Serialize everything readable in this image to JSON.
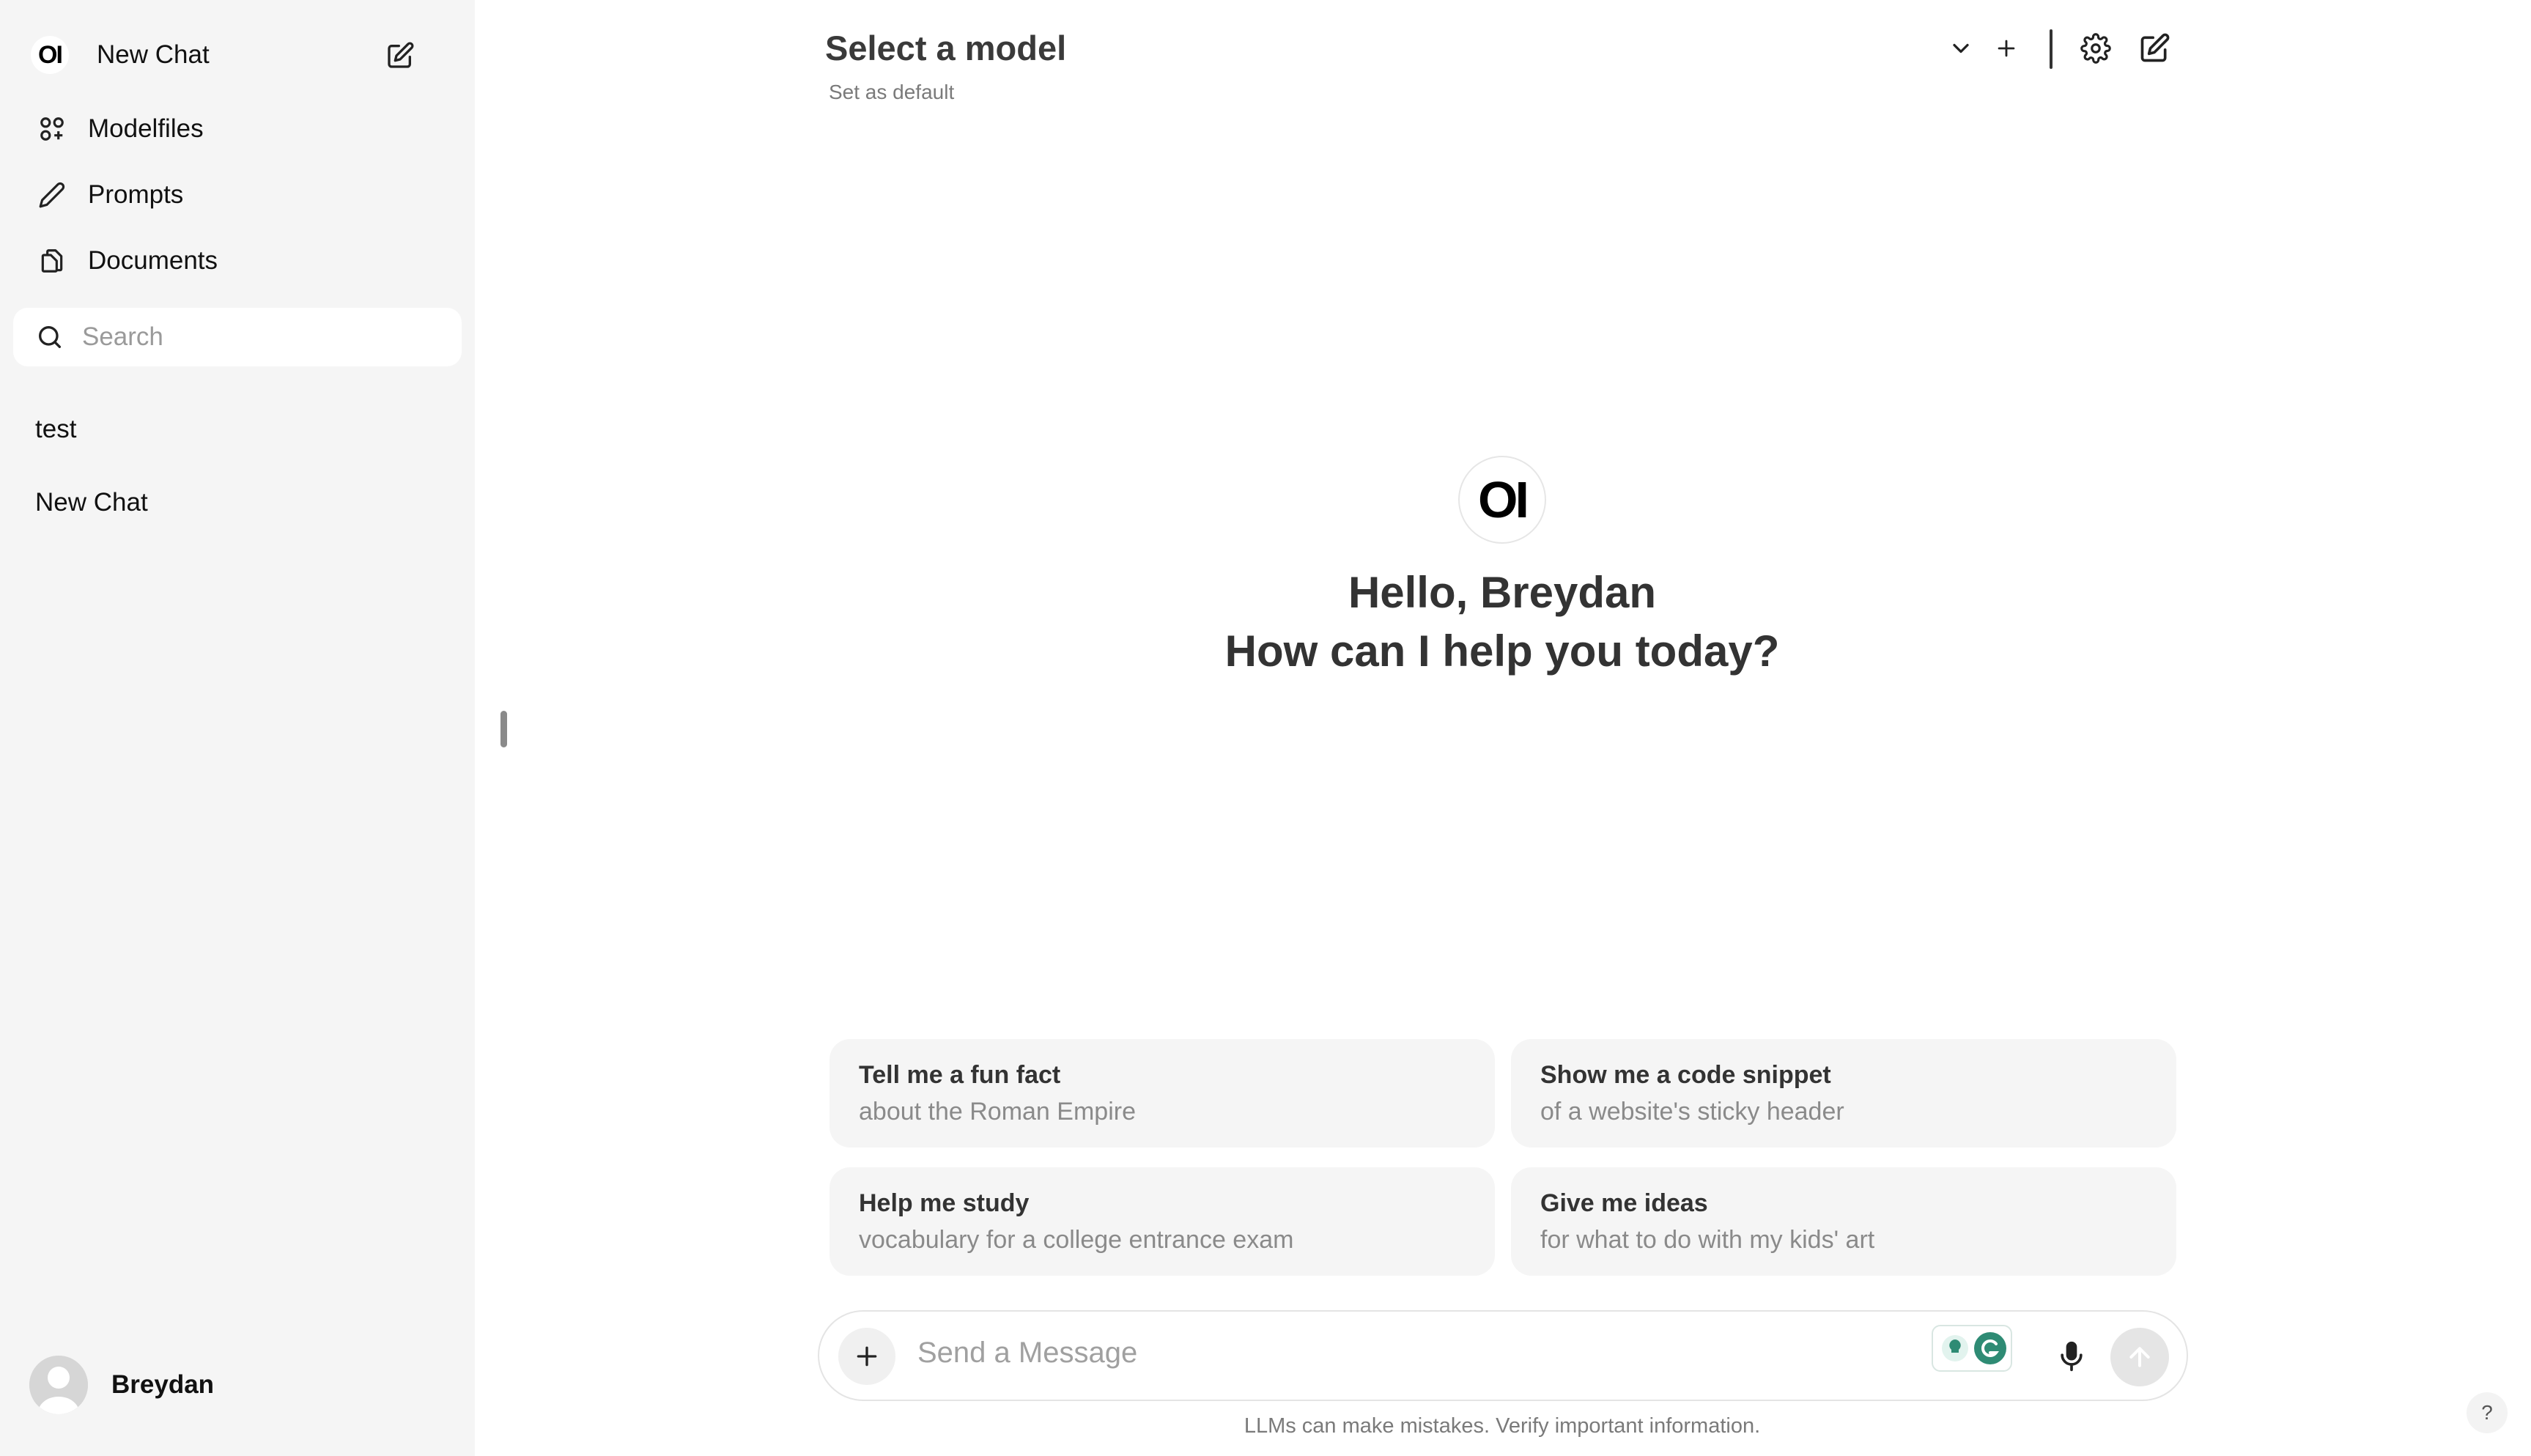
{
  "sidebar": {
    "logo_text": "OI",
    "new_chat_label": "New Chat",
    "nav": [
      {
        "label": "Modelfiles",
        "icon": "grid-plus-icon"
      },
      {
        "label": "Prompts",
        "icon": "pencil-icon"
      },
      {
        "label": "Documents",
        "icon": "documents-icon"
      }
    ],
    "search_placeholder": "Search",
    "chats": [
      "test",
      "New Chat"
    ],
    "user_name": "Breydan"
  },
  "header": {
    "model_title": "Select a model",
    "set_default": "Set as default"
  },
  "main": {
    "logo_text": "OI",
    "greeting_line1": "Hello, Breydan",
    "greeting_line2": "How can I help you today?",
    "suggestions": [
      {
        "title": "Tell me a fun fact",
        "subtitle": "about the Roman Empire"
      },
      {
        "title": "Show me a code snippet",
        "subtitle": "of a website's sticky header"
      },
      {
        "title": "Help me study",
        "subtitle": "vocabulary for a college entrance exam"
      },
      {
        "title": "Give me ideas",
        "subtitle": "for what to do with my kids' art"
      }
    ],
    "message_placeholder": "Send a Message",
    "disclaimer": "LLMs can make mistakes. Verify important information.",
    "help_label": "?"
  },
  "colors": {
    "sidebar_bg": "#f5f5f5",
    "card_bg": "#f5f5f5",
    "extension_green": "#2e8b74"
  }
}
